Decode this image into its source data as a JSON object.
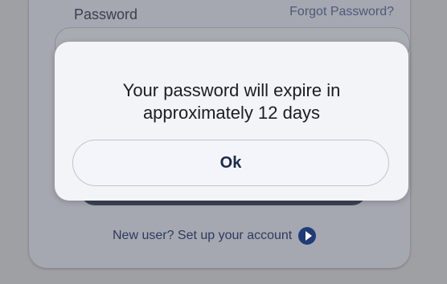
{
  "login": {
    "password_label": "Password",
    "forgot_password": "Forgot Password?",
    "new_user_text": "New user? Set up your account",
    "new_user_icon": "arrow-right-circle-icon"
  },
  "dialog": {
    "message_line1": "Your password will expire in",
    "message_line2": "approximately 12 days",
    "ok_label": "Ok"
  },
  "colors": {
    "overlay_background": "#9fa0a4",
    "dialog_background": "#f3f4f8",
    "accent": "#1f3c78"
  }
}
